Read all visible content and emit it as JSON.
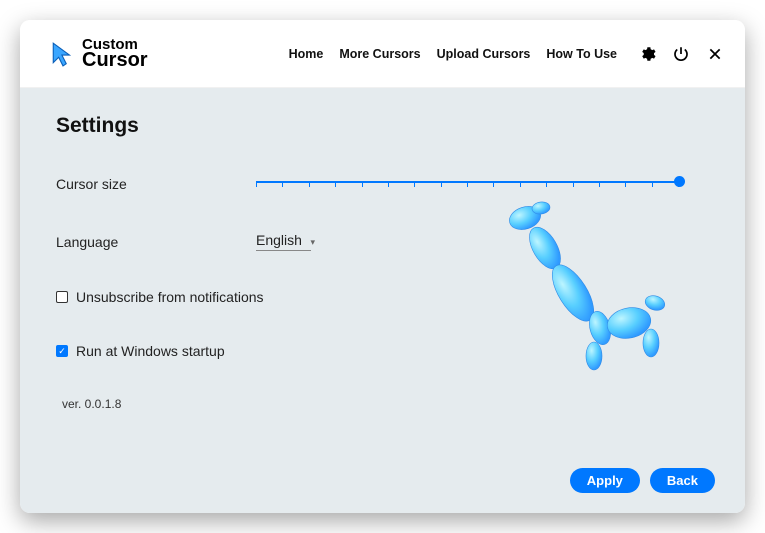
{
  "brand": {
    "line1": "Custom",
    "line2": "Cursor"
  },
  "nav": {
    "home": "Home",
    "more": "More Cursors",
    "upload": "Upload Cursors",
    "howto": "How To Use"
  },
  "page": {
    "title": "Settings",
    "cursor_size_label": "Cursor size",
    "language_label": "Language",
    "language_value": "English",
    "unsubscribe_label": "Unsubscribe from notifications",
    "unsubscribe_checked": false,
    "startup_label": "Run at Windows startup",
    "startup_checked": true,
    "version": "ver. 0.0.1.8"
  },
  "slider": {
    "value_percent": 100,
    "tick_count": 17
  },
  "buttons": {
    "apply": "Apply",
    "back": "Back"
  },
  "colors": {
    "accent": "#0078ff"
  }
}
